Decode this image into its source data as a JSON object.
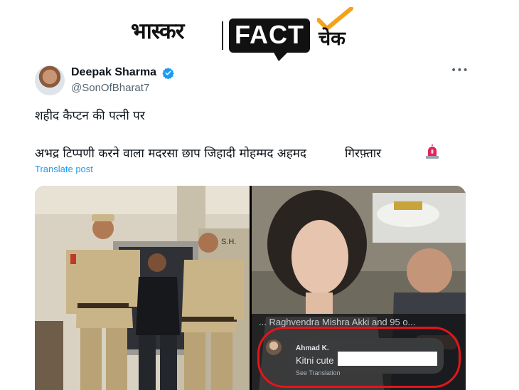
{
  "brand": {
    "publisher": "भास्कर",
    "fact_word": "FACT",
    "check_word": "चेक",
    "colors": {
      "check_mark": "#f4a11b",
      "ink": "#111111"
    }
  },
  "tweet": {
    "display_name": "Deepak Sharma",
    "handle": "@SonOfBharat7",
    "verified": true,
    "icons": [
      "verified-badge-icon",
      "more-icon",
      "siren-icon"
    ],
    "text_line1": "शहीद कैप्टन की पत्नी पर",
    "text_line2": "अभद्र टिप्पणी करने वाला मदरसा छाप जिहादी मोहम्मद अहमद          गिरफ़्तार",
    "translate_label": "Translate post"
  },
  "media": {
    "left_photo_sign": "S.H.",
    "comment": {
      "header": "... Raghvendra Mishra Akki and 95 o...",
      "author": "Ahmad K.",
      "text": "Kitni cute",
      "see_translation": "See Translation"
    }
  },
  "colors": {
    "link": "#1d9bf0",
    "verified": "#1d9bf0",
    "secondary_text": "#536471",
    "highlight_circle": "#e3151b"
  }
}
